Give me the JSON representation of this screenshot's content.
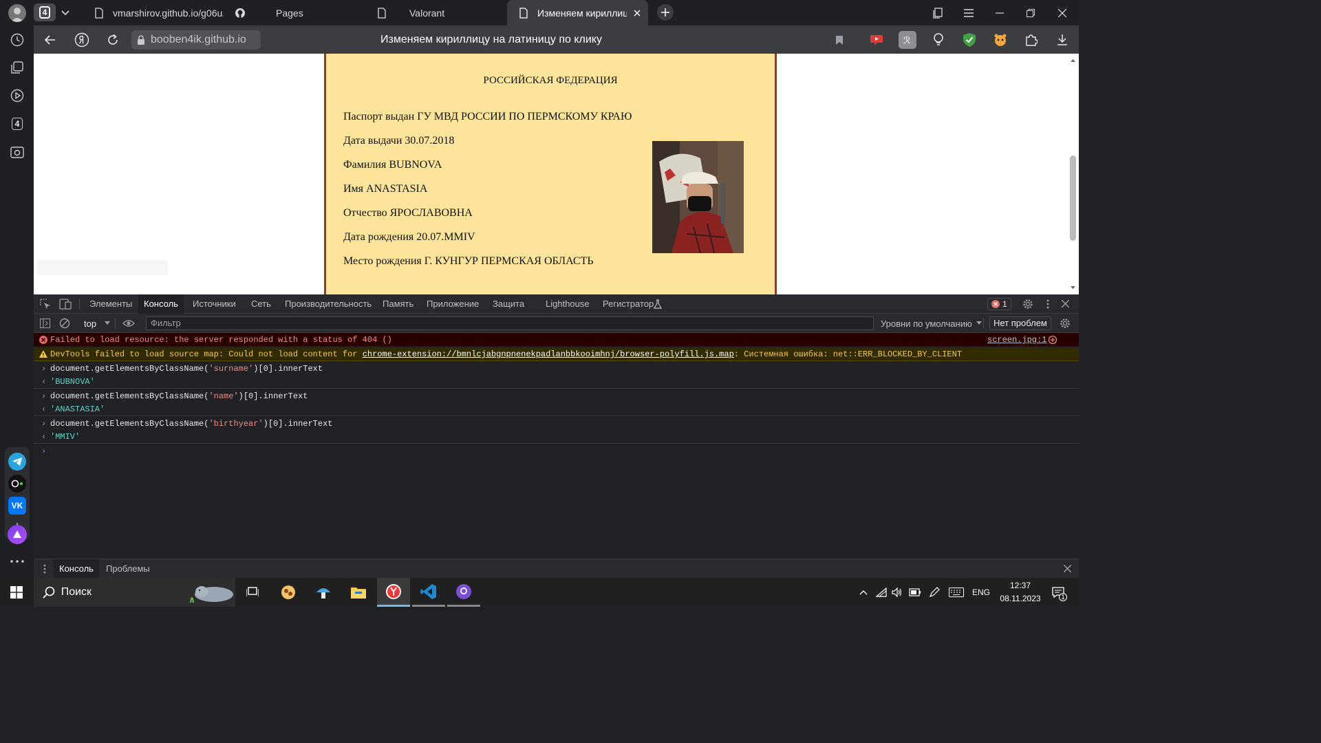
{
  "browser": {
    "tab_count": "4",
    "tabs": [
      {
        "label": "vmarshirov.github.io/g06u..."
      },
      {
        "label": "Pages"
      },
      {
        "label": "Valorant"
      },
      {
        "label": "Изменяем кириллицу н..."
      }
    ],
    "url": "booben4ik.github.io",
    "page_title": "Изменяем кириллицу на латиницу по клику"
  },
  "sidebar": {
    "badge": "4"
  },
  "document": {
    "header": "РОССИЙСКАЯ ФЕДЕРАЦИЯ",
    "issued_by": "Паспорт выдан ГУ МВД РОССИИ ПО ПЕРМСКОМУ КРАЮ",
    "issue_date": "Дата выдачи 30.07.2018",
    "surname": "Фамилия BUBNOVA",
    "name": "Имя ANASTASIA",
    "patronymic": "Отчество ЯРОСЛАВОВНА",
    "birth_date": "Дата рождения 20.07.MMIV",
    "birth_place": "Место рождения Г. КУНГУР ПЕРМСКАЯ ОБЛАСТЬ"
  },
  "devtools": {
    "tabs": [
      "Элементы",
      "Консоль",
      "Источники",
      "Сеть",
      "Производительность",
      "Память",
      "Приложение",
      "Защита",
      "Lighthouse",
      "Регистратор"
    ],
    "active_tab": "Консоль",
    "error_count": "1",
    "context": "top",
    "filter_placeholder": "Фильтр",
    "levels": "Уровни по умолчанию",
    "issues": "Нет проблем",
    "console": {
      "error": "Failed to load resource: the server responded with a status of 404 ()",
      "error_source": "screen.jpg:1",
      "warning_prefix": "DevTools failed to load source map: Could not load content for ",
      "warning_link": "chrome-extension://bmnlcjabgnpnenekpadlanbbkooimhnj/browser-polyfill.js.map",
      "warning_suffix": ": Системная ошибка: net::ERR_BLOCKED_BY_CLIENT",
      "entries": [
        {
          "cmd_pre": "document.getElementsByClassName(",
          "cmd_arg": "'surname'",
          "cmd_post": ")[0].innerText",
          "result": "'BUBNOVA'"
        },
        {
          "cmd_pre": "document.getElementsByClassName(",
          "cmd_arg": "'name'",
          "cmd_post": ")[0].innerText",
          "result": "'ANASTASIA'"
        },
        {
          "cmd_pre": "document.getElementsByClassName(",
          "cmd_arg": "'birthyear'",
          "cmd_post": ")[0].innerText",
          "result": "'MMIV'"
        }
      ]
    },
    "drawer_tabs": [
      "Консоль",
      "Проблемы"
    ]
  },
  "taskbar": {
    "search_label": "Поиск",
    "language": "ENG",
    "time": "12:37",
    "date": "08.11.2023",
    "notification_count": "1"
  },
  "colors": {
    "document_bg": "#fde49b",
    "document_border": "#8a3c2c",
    "error_text": "#f28b82",
    "warning_text": "#f2c94c",
    "result_text": "#5cd5c8"
  }
}
